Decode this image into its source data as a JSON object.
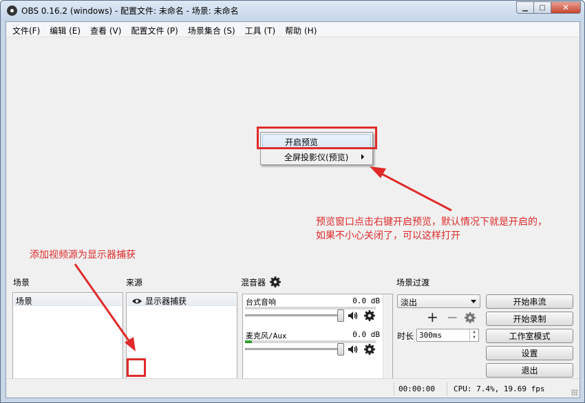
{
  "window": {
    "title": "OBS 0.16.2 (windows) - 配置文件: 未命名 - 场景: 未命名",
    "minimize_glyph": "▁",
    "maximize_glyph": "□",
    "close_glyph": "✕"
  },
  "menu": [
    {
      "label": "文件(F)"
    },
    {
      "label": "编辑 (E)"
    },
    {
      "label": "查看 (V)"
    },
    {
      "label": "配置文件 (P)"
    },
    {
      "label": "场景集合 (S)"
    },
    {
      "label": "工具 (T)"
    },
    {
      "label": "帮助 (H)"
    }
  ],
  "context_menu": {
    "items": [
      {
        "label": "开启预览"
      },
      {
        "label": "全屏投影仪(预览)",
        "has_submenu": true
      }
    ]
  },
  "annotations": {
    "preview_note_line1": "预览窗口点击右键开启预览，默认情况下就是开启的，",
    "preview_note_line2": "如果不小心关闭了，可以这样打开",
    "source_note": "添加视频源为显示器捕获",
    "color": "#e02a2a"
  },
  "scenes": {
    "title": "场景",
    "items": [
      "场景"
    ]
  },
  "sources": {
    "title": "来源",
    "items": [
      {
        "label": "显示器捕获",
        "visible": true
      }
    ]
  },
  "toolbar_glyphs": {
    "add": "+",
    "remove": "−",
    "up": "∧",
    "down": "∨"
  },
  "mixer": {
    "title": "混音器",
    "tracks": [
      {
        "name": "台式音响",
        "db": "0.0 dB",
        "level": 0.0
      },
      {
        "name": "麦克风/Aux",
        "db": "0.0 dB",
        "level": 0.05
      }
    ]
  },
  "transitions": {
    "title": "场景过渡",
    "selected": "淡出",
    "duration_label": "时长",
    "duration_value": "300ms"
  },
  "controls": [
    {
      "label": "开始串流"
    },
    {
      "label": "开始录制"
    },
    {
      "label": "工作室模式"
    },
    {
      "label": "设置"
    },
    {
      "label": "退出"
    }
  ],
  "status": {
    "time": "00:00:00",
    "cpu": "CPU: 7.4%, 19.69 fps"
  }
}
